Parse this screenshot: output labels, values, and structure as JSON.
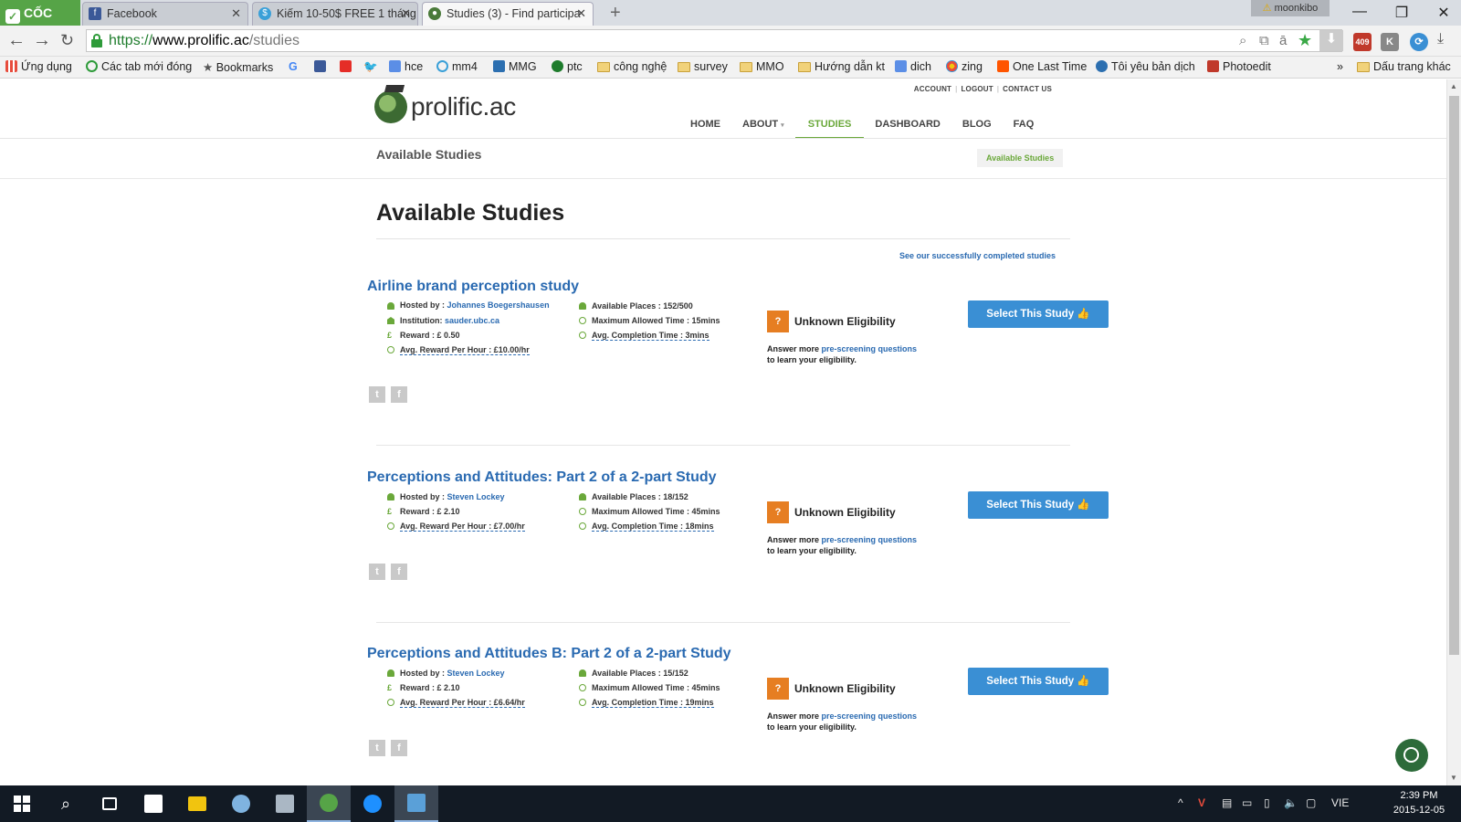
{
  "browser": {
    "tabs": [
      {
        "label": "Facebook"
      },
      {
        "label": "Kiếm 10-50$ FREE 1 tháng"
      },
      {
        "label": "Studies (3) - Find participa"
      }
    ],
    "profile": "moonkibo",
    "url": {
      "scheme": "https://",
      "host": "www.prolific.ac",
      "path": "/studies"
    },
    "extension_badge": "409",
    "bookmarks": [
      "Ứng dụng",
      "Các tab mới đóng",
      "Bookmarks",
      "hce",
      "mm4",
      "MMG",
      "ptc",
      "công nghệ",
      "survey",
      "MMO",
      "Hướng dẫn kt",
      "dich",
      "zing",
      "One Last Time",
      "Tôi yêu bản dịch",
      "Photoedit"
    ],
    "bookmarks_overflow": "»",
    "other_bookmarks": "Dấu trang khác"
  },
  "site": {
    "logo": "prolific.ac",
    "util_links": [
      "ACCOUNT",
      "LOGOUT",
      "CONTACT US"
    ],
    "nav": [
      "HOME",
      "ABOUT",
      "STUDIES",
      "DASHBOARD",
      "BLOG",
      "FAQ"
    ],
    "active_nav": "STUDIES",
    "subheader_title": "Available Studies",
    "breadcrumb": "Available Studies",
    "heading": "Available Studies",
    "completed_link": "See our successfully completed studies"
  },
  "studies": [
    {
      "title": "Airline brand perception study",
      "hosted_by_label": "Hosted by :",
      "host": "Johannes Boegershausen",
      "institution_label": "Institution:",
      "institution": "sauder.ubc.ca",
      "reward": "Reward : £ 0.50",
      "avg_reward": "Avg. Reward Per Hour : £10.00/hr",
      "places": "Available Places : 152/500",
      "max_time": "Maximum Allowed Time : 15mins",
      "avg_time": "Avg. Completion Time : 3mins",
      "eligibility": "Unknown Eligibility",
      "elig_pre": "Answer more ",
      "elig_link": "pre-screening questions",
      "elig_post": "to learn your eligibility.",
      "button": "Select This Study"
    },
    {
      "title": "Perceptions and Attitudes: Part 2 of a 2-part Study",
      "hosted_by_label": "Hosted by :",
      "host": "Steven Lockey",
      "reward": "Reward : £ 2.10",
      "avg_reward": "Avg. Reward Per Hour : £7.00/hr",
      "places": "Available Places : 18/152",
      "max_time": "Maximum Allowed Time : 45mins",
      "avg_time": "Avg. Completion Time : 18mins",
      "eligibility": "Unknown Eligibility",
      "elig_pre": "Answer more ",
      "elig_link": "pre-screening questions",
      "elig_post": "to learn your eligibility.",
      "button": "Select This Study"
    },
    {
      "title": "Perceptions and Attitudes B: Part 2 of a 2-part Study",
      "hosted_by_label": "Hosted by :",
      "host": "Steven Lockey",
      "reward": "Reward : £ 2.10",
      "avg_reward": "Avg. Reward Per Hour : £6.64/hr",
      "places": "Available Places : 15/152",
      "max_time": "Maximum Allowed Time : 45mins",
      "avg_time": "Avg. Completion Time : 19mins",
      "eligibility": "Unknown Eligibility",
      "elig_pre": "Answer more ",
      "elig_link": "pre-screening questions",
      "elig_post": "to learn your eligibility.",
      "button": "Select This Study"
    }
  ],
  "taskbar": {
    "language": "VIE",
    "time": "2:39 PM",
    "date": "2015-12-05"
  },
  "colors": {
    "accent_green": "#6aa83a",
    "link_blue": "#2a6ab1",
    "button_blue": "#3a8fd4",
    "eligibility_orange": "#e67e22"
  }
}
